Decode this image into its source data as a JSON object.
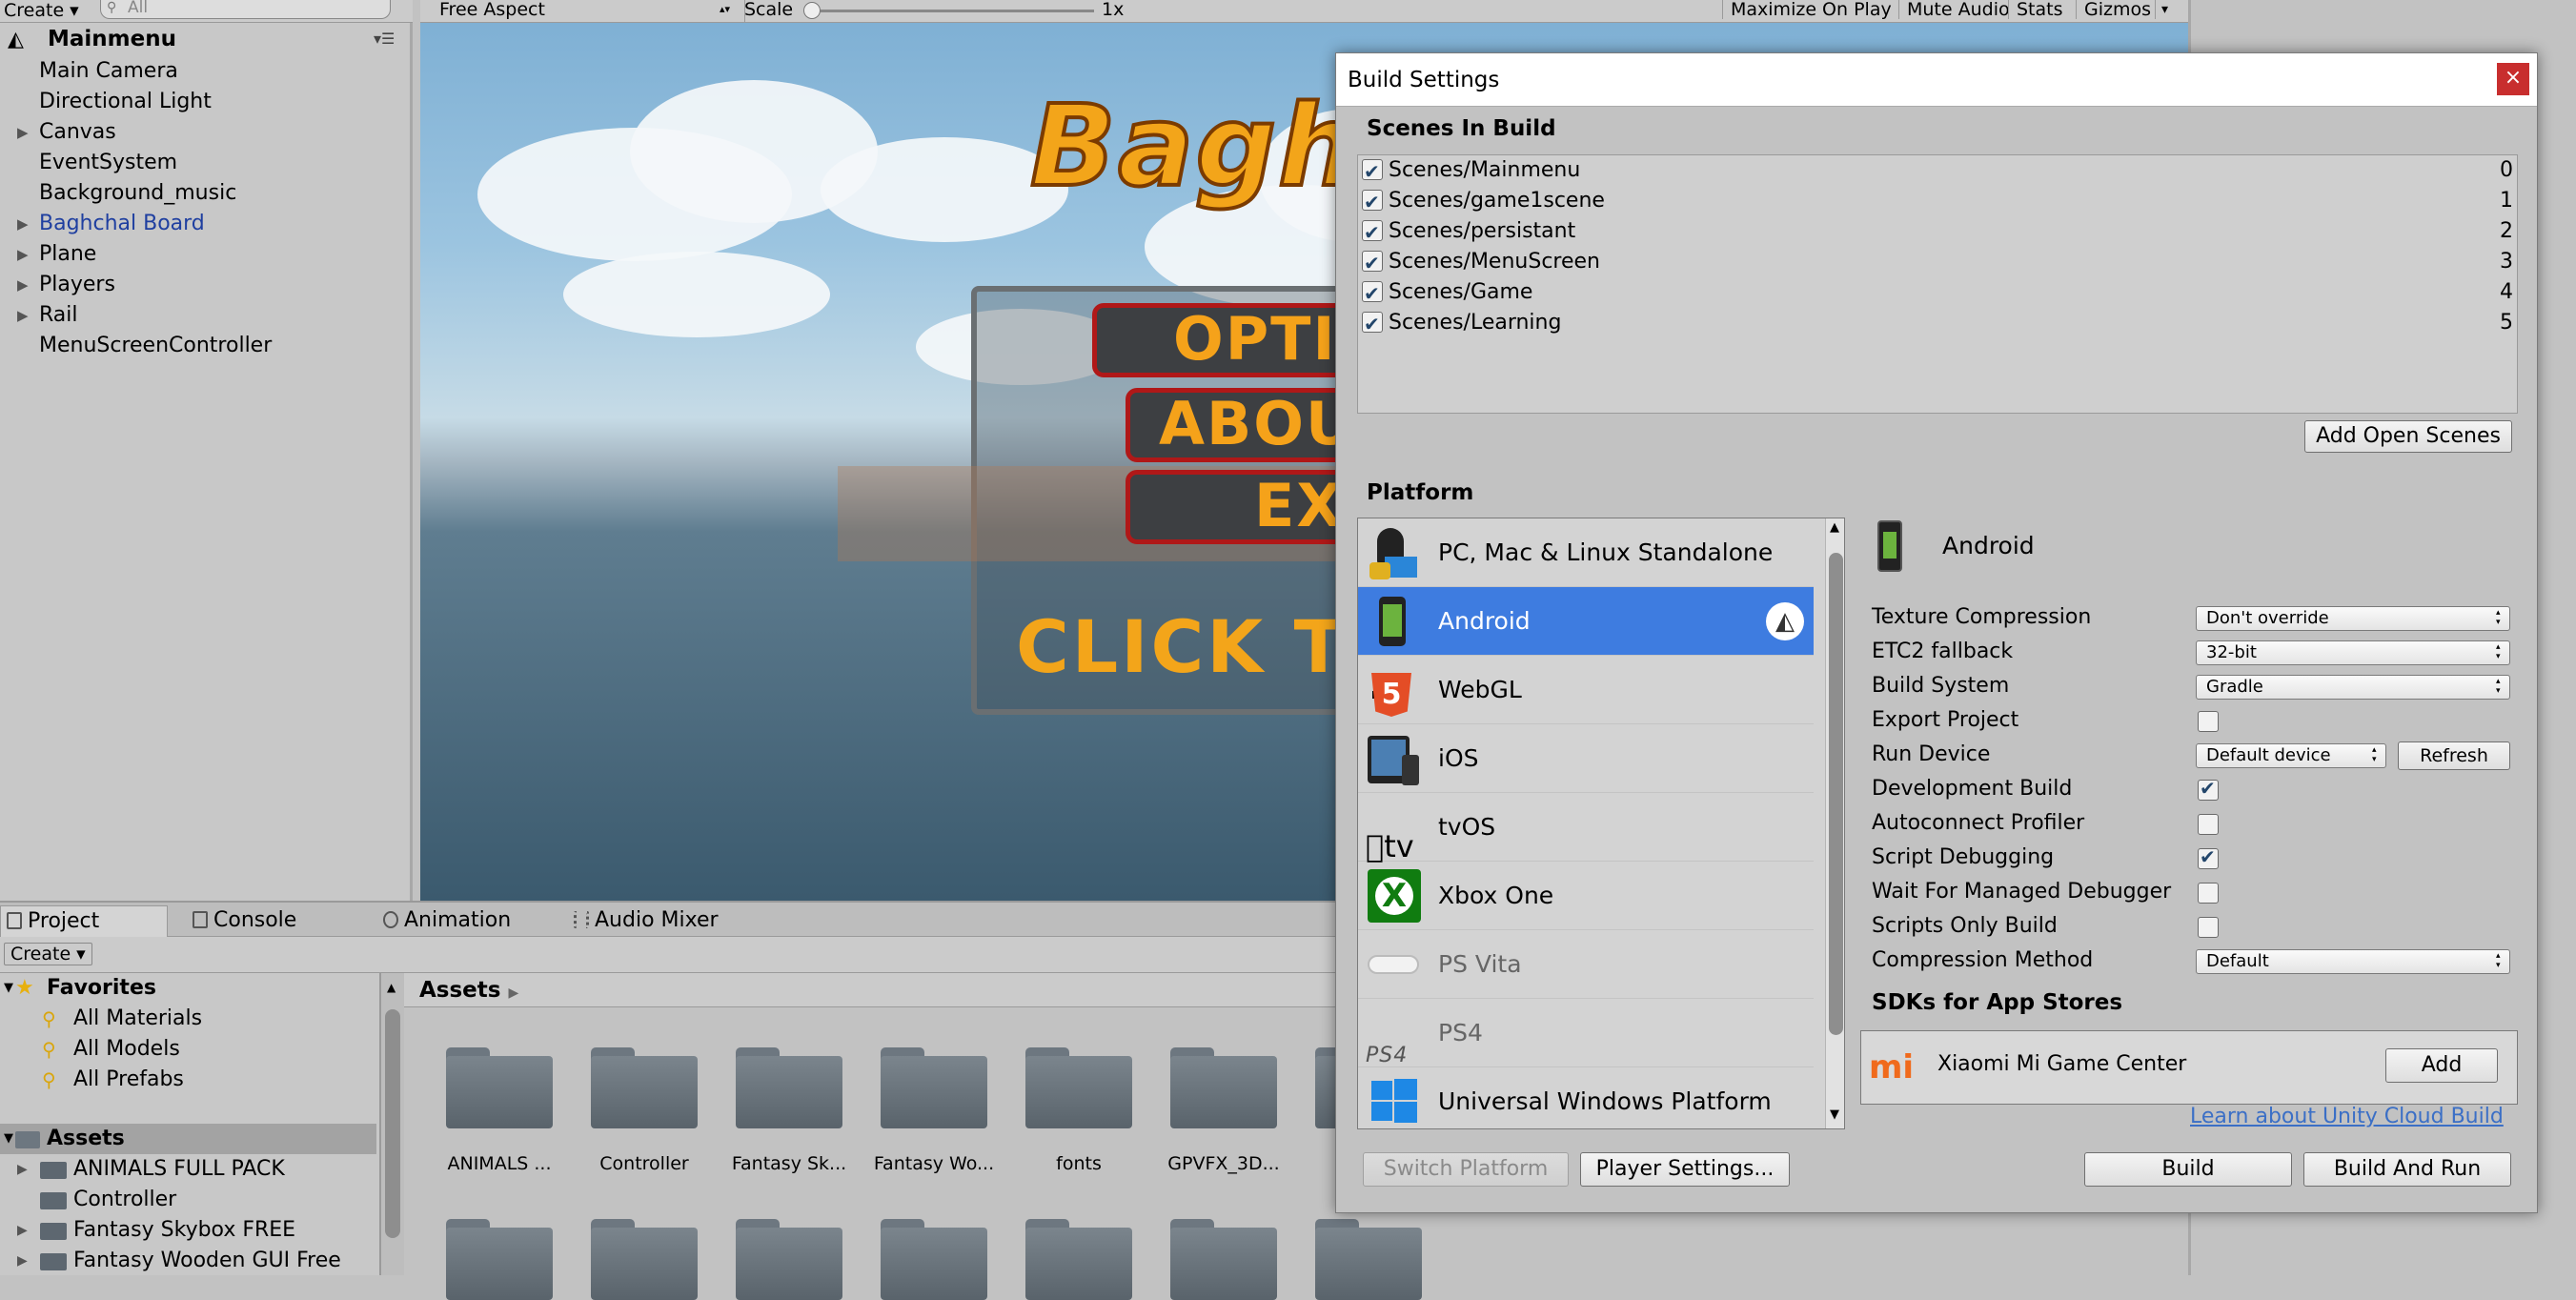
{
  "hierarchy": {
    "create_label": "Create",
    "search_placeholder": "All",
    "scene_name": "Mainmenu",
    "items": [
      {
        "label": "Main Camera",
        "expandable": false,
        "color": "#000000"
      },
      {
        "label": "Directional Light",
        "expandable": false,
        "color": "#000000"
      },
      {
        "label": "Canvas",
        "expandable": true,
        "color": "#000000"
      },
      {
        "label": "EventSystem",
        "expandable": false,
        "color": "#000000"
      },
      {
        "label": "Background_music",
        "expandable": false,
        "color": "#000000"
      },
      {
        "label": "Baghchal Board",
        "expandable": true,
        "color": "#1f3fa0"
      },
      {
        "label": "Plane",
        "expandable": true,
        "color": "#000000"
      },
      {
        "label": "Players",
        "expandable": true,
        "color": "#000000"
      },
      {
        "label": "Rail",
        "expandable": true,
        "color": "#000000"
      },
      {
        "label": "MenuScreenController",
        "expandable": false,
        "color": "#000000"
      }
    ]
  },
  "game": {
    "aspect": "Free Aspect",
    "scale_label": "Scale",
    "scale_value": "1x",
    "maximize": "Maximize On Play",
    "mute": "Mute Audio",
    "stats": "Stats",
    "gizmos": "Gizmos",
    "logo_text": "BaghL",
    "buttons": [
      "OPTIO",
      "ABOU",
      "EXIT"
    ],
    "click_text": "CLICK TO"
  },
  "bottom": {
    "tabs": [
      "Project",
      "Console",
      "Animation",
      "Audio Mixer"
    ],
    "create_label": "Create",
    "favorites_label": "Favorites",
    "favorites": [
      "All Materials",
      "All Models",
      "All Prefabs"
    ],
    "assets_label": "Assets",
    "asset_tree": [
      "ANIMALS FULL PACK",
      "Controller",
      "Fantasy Skybox FREE",
      "Fantasy Wooden GUI  Free"
    ],
    "breadcrumb": "Assets",
    "folders": [
      "ANIMALS ...",
      "Controller",
      "Fantasy Sk...",
      "Fantasy Wo...",
      "fonts",
      "GPVFX_3D..."
    ]
  },
  "build": {
    "title": "Build Settings",
    "close": "×",
    "scenes_header": "Scenes In Build",
    "scenes": [
      {
        "name": "Scenes/Mainmenu",
        "index": "0"
      },
      {
        "name": "Scenes/game1scene",
        "index": "1"
      },
      {
        "name": "Scenes/persistant",
        "index": "2"
      },
      {
        "name": "Scenes/MenuScreen",
        "index": "3"
      },
      {
        "name": "Scenes/Game",
        "index": "4"
      },
      {
        "name": "Scenes/Learning",
        "index": "5"
      }
    ],
    "add_open_scenes": "Add Open Scenes",
    "platform_header": "Platform",
    "platforms": [
      "PC, Mac & Linux Standalone",
      "Android",
      "WebGL",
      "iOS",
      "tvOS",
      "Xbox One",
      "PS Vita",
      "PS4",
      "Universal Windows Platform"
    ],
    "selected_platform": "Android",
    "settings": {
      "texture_compression_label": "Texture Compression",
      "texture_compression": "Don't override",
      "etc2_label": "ETC2 fallback",
      "etc2": "32-bit",
      "build_system_label": "Build System",
      "build_system": "Gradle",
      "export_label": "Export Project",
      "run_device_label": "Run Device",
      "run_device": "Default device",
      "refresh": "Refresh",
      "dev_build_label": "Development Build",
      "autoconnect_label": "Autoconnect Profiler",
      "script_debug_label": "Script Debugging",
      "wait_debugger_label": "Wait For Managed Debugger",
      "scripts_only_label": "Scripts Only Build",
      "compression_label": "Compression Method",
      "compression": "Default"
    },
    "sdk_header": "SDKs for App Stores",
    "sdk_name": "Xiaomi Mi Game Center",
    "sdk_add": "Add",
    "cloud_link": "Learn about Unity Cloud Build",
    "switch_platform": "Switch Platform",
    "player_settings": "Player Settings...",
    "build_btn": "Build",
    "build_and_run": "Build And Run"
  }
}
